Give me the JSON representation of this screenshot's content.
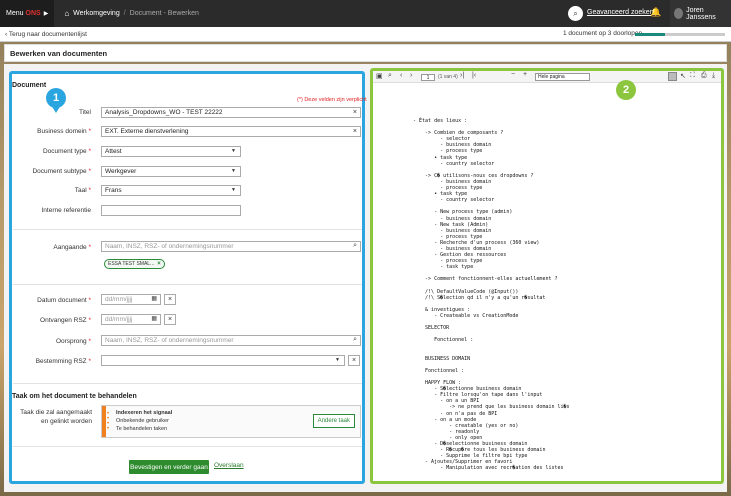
{
  "topbar": {
    "menu": "Menu",
    "menu_brand": "ONS",
    "menu_arrow": "▶",
    "home_icon": "home-icon",
    "workspace": "Werkomgeving",
    "separator": "/",
    "current": "Document - Bewerken",
    "advanced_search": "Geavanceerd zoeken",
    "user_name": "Joren Janssens"
  },
  "subbar": {
    "back_label": "Terug naar documentenlijst",
    "progress_text": "1 document op 3 doorlopen",
    "progress_fraction": 0.33
  },
  "page_title": "Bewerken van documenten",
  "form": {
    "section_title": "Document",
    "required_note": "(*) Deze velden zijn verplicht",
    "badge_number": "1",
    "titel": {
      "label": "Titel",
      "value": "Analysis_Dropdowns_WO - TEST 22222"
    },
    "business_domein": {
      "label": "Business domein",
      "value": "EXT. Externe dienstverlening"
    },
    "document_type": {
      "label": "Document type",
      "value": "Attest"
    },
    "document_subtype": {
      "label": "Document subtype",
      "value": "Werkgever"
    },
    "taal": {
      "label": "Taal",
      "value": "Frans"
    },
    "interne_referentie": {
      "label": "Interne referentie",
      "value": ""
    },
    "aangaande": {
      "label": "Aangaande",
      "placeholder": "Naam, INSZ, RSZ- of ondernemingsnummer",
      "chip": "ESSA TEST SMAL..."
    },
    "datum_document": {
      "label": "Datum document",
      "placeholder": "dd/mm/jjjj"
    },
    "ontvangen_rsz": {
      "label": "Ontvangen RSZ",
      "placeholder": "dd/mm/jjjj"
    },
    "oorsprong": {
      "label": "Oorsprong",
      "placeholder": "Naam, INSZ, RSZ- of ondernemingsnummer"
    },
    "bestemming_rsz": {
      "label": "Bestemming RSZ",
      "value": ""
    },
    "star": "*",
    "clear": "×"
  },
  "task": {
    "section_title": "Taak om het document te behandelen",
    "label": "Taak die zal aangemaakt en gelinkt worden",
    "line1": "Indexeren het signaal",
    "line2": "Onbekende gebruiker",
    "line3": "Te behandelen taken",
    "other_button": "Andere taak",
    "accent_color": "#f08020"
  },
  "actions": {
    "confirm": "Bevestigen en verder gaan",
    "skip": "Overslaan"
  },
  "viewer": {
    "badge_number": "2",
    "page_input": "1",
    "page_of": "(1 van 4)",
    "zoom": "Hele pagina",
    "document_text": "- État des lieux :\n\n    -> Combien de composants ?\n         - selector\n         - business domain\n         - process type\n       • task type\n         - country selector\n\n    -> C� utilisons-nous ces dropdowns ?\n         - business domain\n         - process type\n       • task type\n         - country selector\n\n       - New process type (admin)\n         - business domain\n       - New task (Admin)\n         - business domain\n         - process type\n       - Recherche d'un process (360 view)\n         - business domain\n       - Gestion des ressources\n         - process type\n         - task type\n\n    -> Comment fonctionnent-elles actuellement ?\n\n    /!\\ DefaultValueCode (@Input())\n    /!\\ S�lection qd il n'y a qu'un r�sultat\n\n    & investigues :\n       - Createable vs CreationMode\n\n    SELECTOR\n\n       Fonctionnel :\n\n\n    BUSINESS DOMAIN\n\n    Fonctionnel :\n\n    HAPPY FLOW :\n       - S�lectionne business domain\n       - Filtre lorsqu'on tape dans l'input\n         - on a un BPI\n            -> ne prend que les business domain li�s\n         - on n'a pas de BPI\n       - on a un mode\n            - creatable (yes or no)\n            - readonly\n            - only open\n       - D�selectionne business domain\n         - R�cup�re tous les business domain\n         - Supprime le filtre bpi type\n    - Ajoutes/Supprimer en favori\n         - Manipulation avec recr�ation des listes"
  }
}
